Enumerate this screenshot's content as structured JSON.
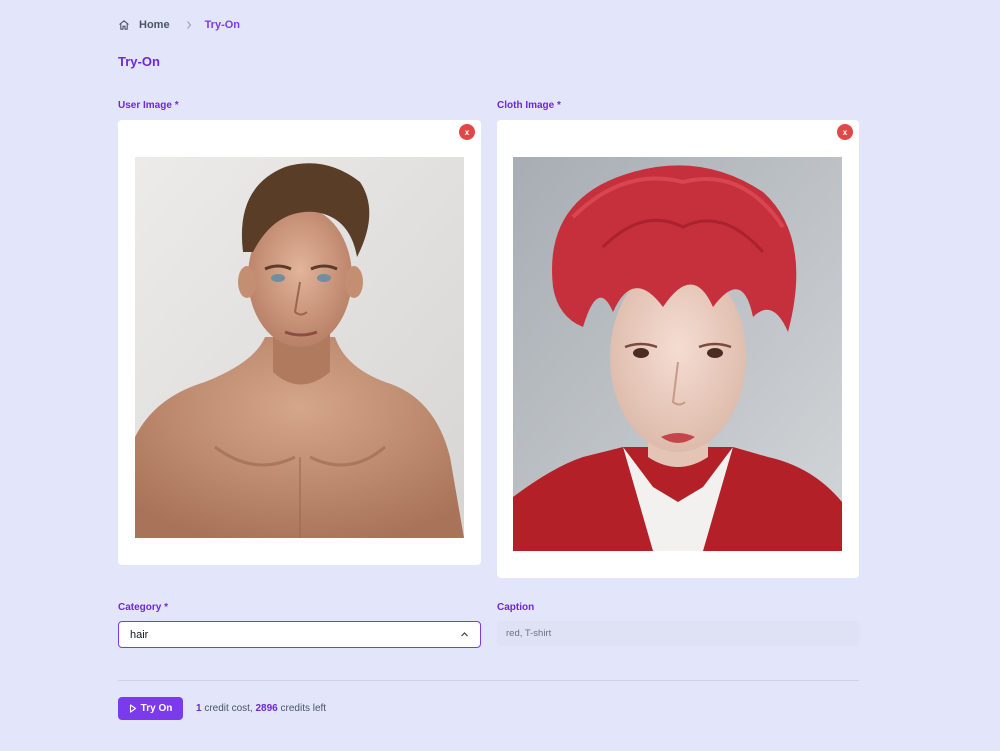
{
  "breadcrumb": {
    "home": "Home",
    "current": "Try-On"
  },
  "page_title": "Try-On",
  "user_image": {
    "label": "User Image *",
    "remove_label": "x"
  },
  "cloth_image": {
    "label": "Cloth Image *",
    "remove_label": "x"
  },
  "category": {
    "label": "Category *",
    "value": "hair"
  },
  "caption": {
    "label": "Caption",
    "placeholder": "red, T-shirt"
  },
  "action": {
    "button_label": "Try On"
  },
  "credits": {
    "cost": "1",
    "cost_text": "credit cost,",
    "left": "2896",
    "left_text": "credits left"
  },
  "icons": {
    "home": "home-icon",
    "separator": "chevron-right-icon",
    "select": "chevron-up-icon",
    "play": "play-icon"
  },
  "colors": {
    "accent": "#7c3aed",
    "background": "#e3e5fa",
    "remove": "#e04848"
  }
}
